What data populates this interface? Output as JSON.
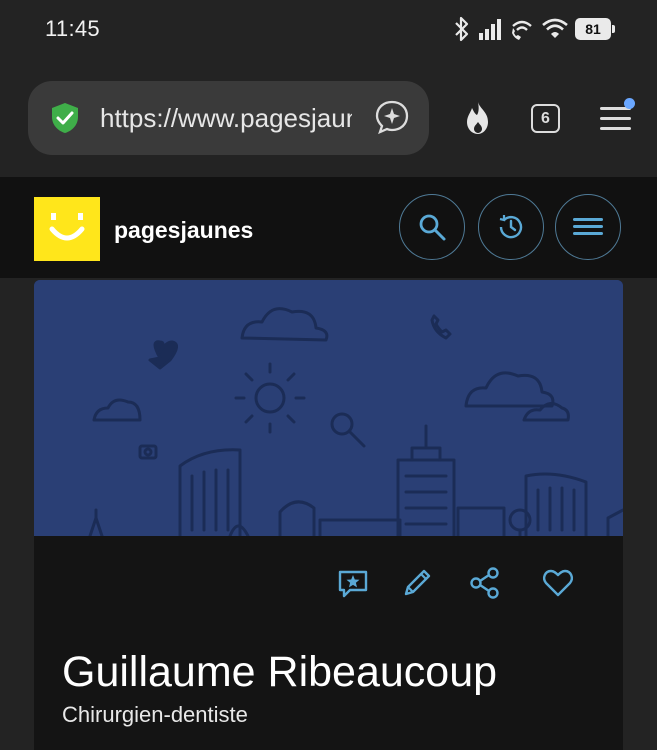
{
  "status_bar": {
    "time": "11:45",
    "battery": "81"
  },
  "browser": {
    "url": "https://www.pagesjaunes.fr",
    "tab_count": "6"
  },
  "site": {
    "name": "pagesjaunes"
  },
  "listing": {
    "name": "Guillaume Ribeaucoup",
    "profession": "Chirurgien-dentiste"
  },
  "colors": {
    "logo_yellow": "#ffe61b",
    "accent_blue": "#5aa9d6",
    "banner_blue": "#2a3f75"
  }
}
